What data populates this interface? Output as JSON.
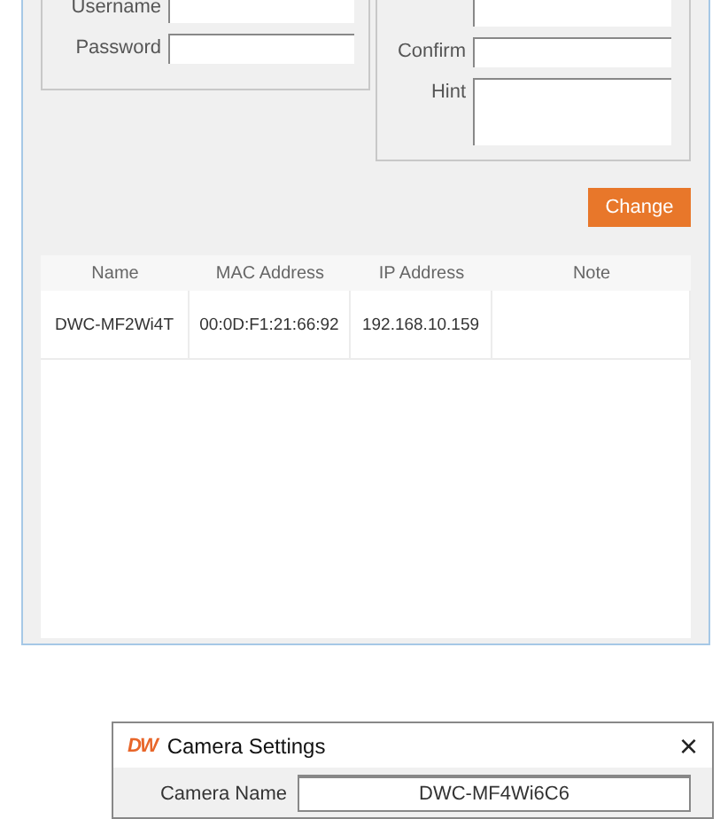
{
  "login_group": {
    "fields": [
      {
        "label": "Username"
      },
      {
        "label": "Password"
      }
    ]
  },
  "password_group": {
    "fields": [
      {
        "kind": "single"
      },
      {
        "label": "Confirm",
        "kind": "single"
      },
      {
        "label": "Hint",
        "kind": "multiline"
      }
    ]
  },
  "change_button": "Change",
  "table": {
    "columns": [
      "Name",
      "MAC Address",
      "IP Address",
      "Note"
    ],
    "rows": [
      [
        "DWC-MF2Wi4T",
        "00:0D:F1:21:66:92",
        "192.168.10.159",
        null
      ]
    ]
  },
  "camera_settings": {
    "logo": "DW",
    "title": "Camera Settings",
    "close": "×",
    "fields": [
      {
        "label": "Camera Name",
        "value": "DWC-MF4Wi6C6"
      }
    ]
  }
}
